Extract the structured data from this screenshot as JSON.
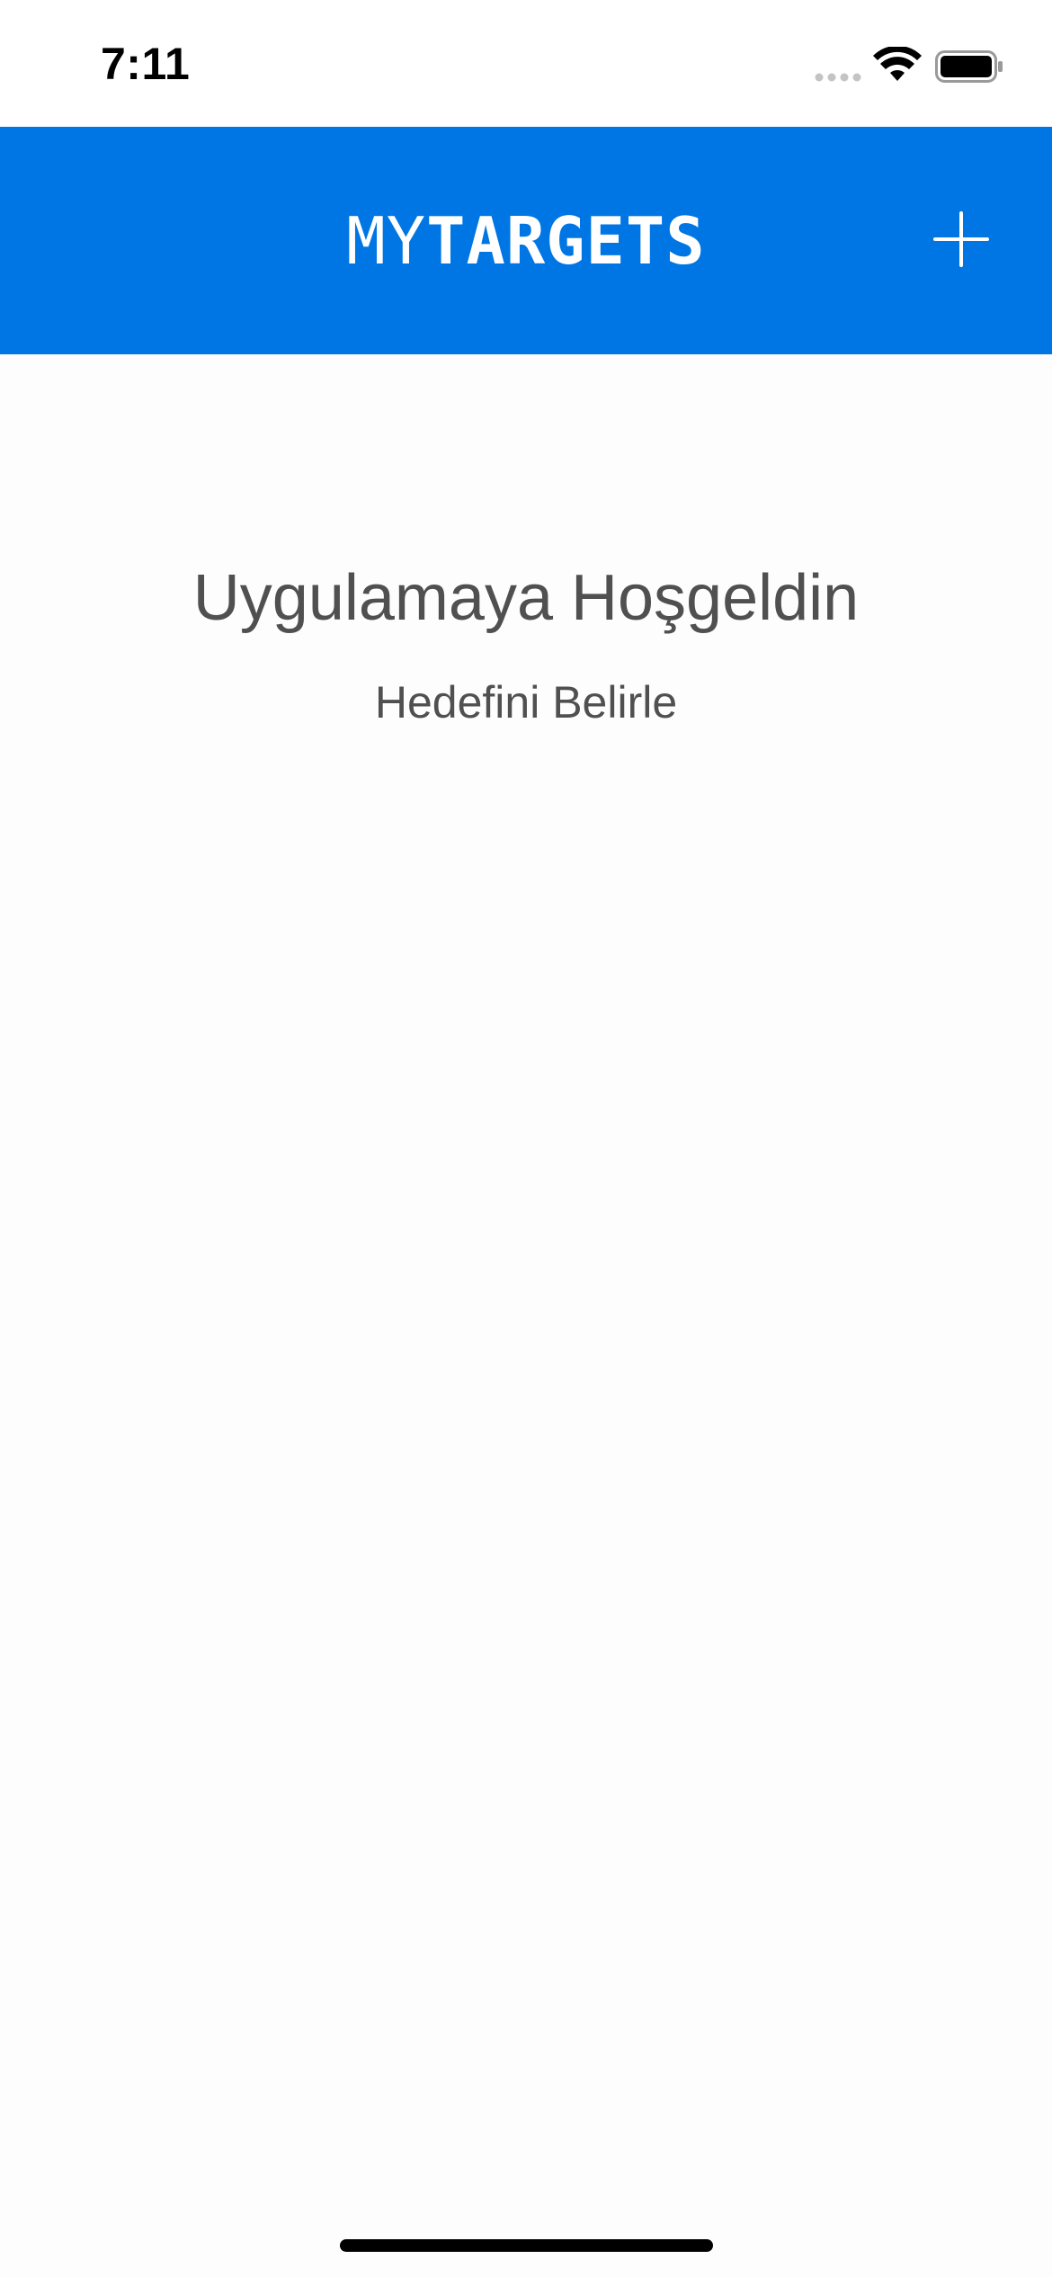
{
  "status_bar": {
    "time": "7:11"
  },
  "nav": {
    "title_light": "MY",
    "title_bold": "TARGETS",
    "add_icon": "plus-icon"
  },
  "main": {
    "welcome_title": "Uygulamaya Hoşgeldin",
    "welcome_subtitle": "Hedefini Belirle"
  },
  "colors": {
    "accent": "#0076e4",
    "text": "#505050",
    "background": "#fdfdfd"
  }
}
